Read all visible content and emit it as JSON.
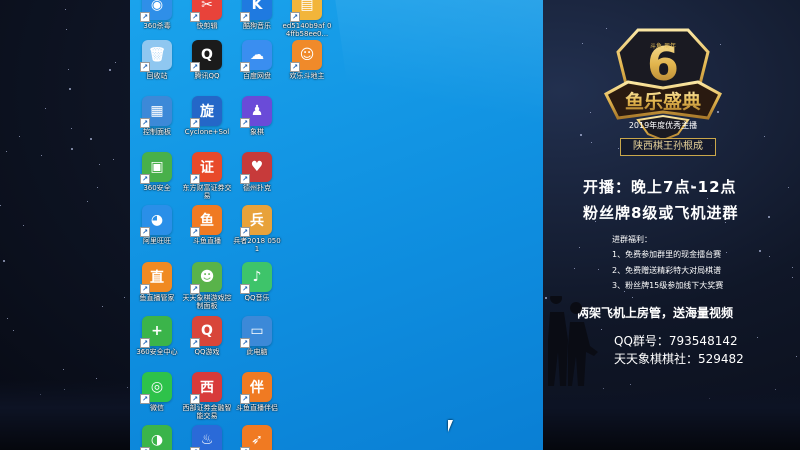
{
  "desktop": {
    "icons": [
      {
        "label": "360杀毒",
        "icon": "shield-icon",
        "color": "#2f8fe8",
        "glyph": "◉"
      },
      {
        "label": "快剪辑",
        "icon": "scissors-icon",
        "color": "#e8433a",
        "glyph": "✂"
      },
      {
        "label": "酷狗音乐",
        "icon": "music-icon",
        "color": "#1f7ae0",
        "glyph": "K"
      },
      {
        "label": "ed5140b9af 04ffb58ee0...",
        "icon": "folder-icon",
        "color": "#f2b53a",
        "glyph": "▤"
      },
      {
        "label": "回收站",
        "icon": "recycle-bin-icon",
        "color": "#8fc7f0",
        "glyph": "🗑"
      },
      {
        "label": "腾讯QQ",
        "icon": "qq-icon",
        "color": "#1b1b1b",
        "glyph": "Q"
      },
      {
        "label": "百度网盘",
        "icon": "cloud-icon",
        "color": "#3a8ef0",
        "glyph": "☁"
      },
      {
        "label": "欢乐斗地主",
        "icon": "game-icon",
        "color": "#f08a2a",
        "glyph": "☺"
      },
      {
        "label": "控制面板",
        "icon": "control-panel-icon",
        "color": "#3c89d8",
        "glyph": "▦"
      },
      {
        "label": "Cyclone+Sol",
        "icon": "spin-icon",
        "color": "#2467c8",
        "glyph": "旋"
      },
      {
        "label": "象棋",
        "icon": "chess-icon",
        "color": "#6a4bd8",
        "glyph": "♟"
      },
      {
        "label": "360安全",
        "icon": "security-icon",
        "color": "#48b04a",
        "glyph": "▣"
      },
      {
        "label": "东方财富证券交易",
        "icon": "stock-icon",
        "color": "#e84a2a",
        "glyph": "证"
      },
      {
        "label": "德州扑克",
        "icon": "cards-icon",
        "color": "#c73a3a",
        "glyph": "♥"
      },
      {
        "label": "阿里旺旺",
        "icon": "wangwang-icon",
        "color": "#2a8fe8",
        "glyph": "◕"
      },
      {
        "label": "斗鱼直播",
        "icon": "douyu-icon",
        "color": "#f07a22",
        "glyph": "鱼"
      },
      {
        "label": "兵者2018 0501",
        "icon": "soldier-icon",
        "color": "#e8a23a",
        "glyph": "兵"
      },
      {
        "label": "鱼直播管家",
        "icon": "live-icon",
        "color": "#f08a22",
        "glyph": "直"
      },
      {
        "label": "天天象棋游戏控制面板",
        "icon": "frog-icon",
        "color": "#59b34a",
        "glyph": "☻"
      },
      {
        "label": "QQ音乐",
        "icon": "qqmusic-icon",
        "color": "#3ec46a",
        "glyph": "♪"
      },
      {
        "label": "360安全中心",
        "icon": "plus-icon",
        "color": "#3bb44a",
        "glyph": "+"
      },
      {
        "label": "QQ游戏",
        "icon": "qqgame-icon",
        "color": "#d8463a",
        "glyph": "Q"
      },
      {
        "label": "此电脑",
        "icon": "computer-icon",
        "color": "#3c89d8",
        "glyph": "▭"
      },
      {
        "label": "微信",
        "icon": "wechat-icon",
        "color": "#2ec24a",
        "glyph": "◎"
      },
      {
        "label": "西部证券金融智能交易",
        "icon": "broker-icon",
        "color": "#d83a3a",
        "glyph": "西"
      },
      {
        "label": "斗鱼直播伴侣",
        "icon": "companion-icon",
        "color": "#f07a22",
        "glyph": "伴"
      },
      {
        "label": "",
        "icon": "app-icon",
        "color": "#3bb44a",
        "glyph": "◑"
      },
      {
        "label": "",
        "icon": "app-icon",
        "color": "#2a6ad8",
        "glyph": "♨"
      },
      {
        "label": "",
        "icon": "app-icon",
        "color": "#f07a22",
        "glyph": "➶"
      }
    ]
  },
  "panel": {
    "badge_number": "6",
    "badge_small": "斗鱼 周年",
    "badge_title": "鱼乐盛典",
    "badge_sub": "2019年度优秀主播",
    "streamer": "陕西棋王孙根成",
    "schedule": "开播：晚上7点-12点",
    "join": "粉丝牌8级或飞机进群",
    "benefits_title": "进群福利：",
    "benefits": [
      "1、免费参加群里的现金擂台赛",
      "2、免费赠送精彩特大对局棋谱",
      "3、粉丝牌15级参加线下大奖赛"
    ],
    "promo": "两架飞机上房管，送海量视频",
    "qq_group": "QQ群号：793548142",
    "club": "天天象棋棋社：529482"
  },
  "colors": {
    "desktop": "#1497e6",
    "gold": "#e8c15a"
  }
}
